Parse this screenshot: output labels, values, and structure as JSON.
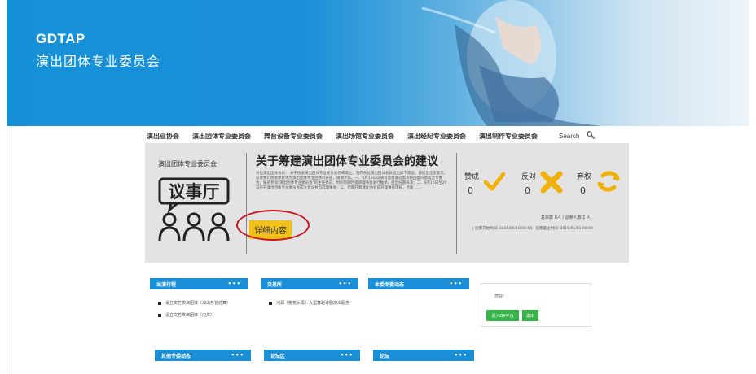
{
  "brand": {
    "code": "GDTAP",
    "name": "演出团体专业委员会"
  },
  "nav": {
    "items": [
      "演出业协会",
      "演出团体专业委员会",
      "舞台设备专业委员会",
      "演出场馆专业委员会",
      "演出经纪专业委员会",
      "演出制作专业委员会"
    ],
    "search_label": "Search"
  },
  "feature": {
    "side_title": "演出团体专业委员会",
    "logo_text": "议事厅",
    "headline": "关于筹建演出团体专业委员会的建议",
    "body": "各位演出团体会员： 关于协会演出团体专业委员会尚未成立，我向各位演出团体会员提出如下建议，请提出宝贵意见，以便我们协会更好地为演出团体专业团体的开展，谢谢大家。一、6月15日前请有意者通过此系统回复同意成立专委会，报名参加\"演出团体专业委员会\"的主任委员；时间到期时提请理事会进行推举，提出任期表决；二、6月16日至20日召开演出团体专业委员会成立会议并当选理事会；三、若能在筹建此协会前对理事会审核，后附 ……",
    "detail_label": "详细内容",
    "votes": [
      {
        "label": "赞成",
        "count": "0"
      },
      {
        "label": "反对",
        "count": "0"
      },
      {
        "label": "弃权",
        "count": "0"
      }
    ],
    "stats_line1": "总票数 0人 / 总参人数 1 人",
    "stats_line2": "| 投票开始时间: 2015/05/18 00:00 | 投票截止时间: 2015/06/01 00:00",
    "colors": {
      "accent": "#f2c21a",
      "circle": "#c8161d"
    }
  },
  "widgets": [
    {
      "title": "出演行程",
      "more": "•••",
      "items": [
        "设立文艺类演团体（演出存管结算）",
        "设立文艺类演团体（内资）"
      ]
    },
    {
      "title": "交易所",
      "more": "•••",
      "items": [
        "河源《桃花水母》大型舞蹈诗剧演出服务"
      ]
    },
    {
      "title": "本委专委动态",
      "more": "•••",
      "items": []
    },
    {
      "title": "其他专委动态",
      "more": "•••",
      "items": []
    },
    {
      "title": "论坛区",
      "more": "•••",
      "items": []
    },
    {
      "title": "论坛",
      "more": "•••",
      "items": []
    }
  ],
  "login": {
    "greeting": "您好!",
    "oa_button": "进入OA平台",
    "logout_button": "退出"
  },
  "header_color": "#1a8fd8"
}
